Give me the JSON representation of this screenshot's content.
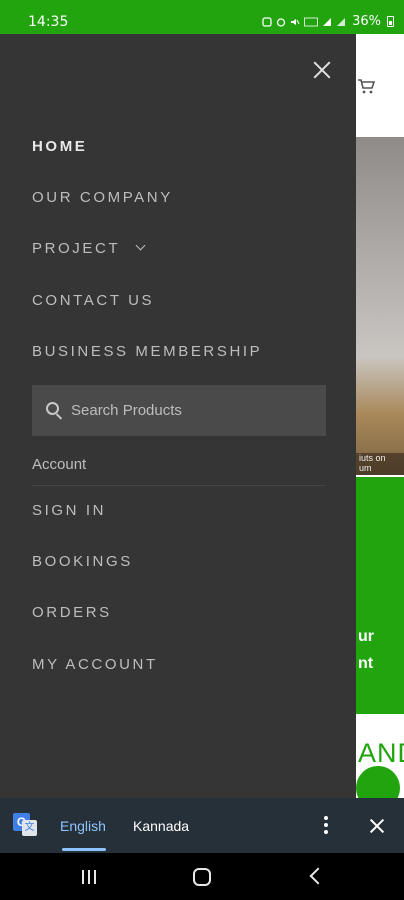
{
  "status_bar": {
    "time": "14:35",
    "battery": "36%",
    "icons": [
      "nfc-icon",
      "alarm-icon",
      "mute-icon",
      "volte-icon",
      "signal-icon",
      "signal-icon",
      "battery-icon"
    ]
  },
  "drawer": {
    "menu": [
      {
        "label": "HOME",
        "active": true
      },
      {
        "label": "OUR COMPANY"
      },
      {
        "label": "PROJECT",
        "has_dropdown": true
      },
      {
        "label": "CONTACT US"
      },
      {
        "label": "BUSINESS MEMBERSHIP"
      }
    ],
    "search": {
      "placeholder": "Search Products",
      "value": ""
    },
    "account": {
      "heading": "Account",
      "items": [
        {
          "label": "SIGN IN"
        },
        {
          "label": "BOOKINGS"
        },
        {
          "label": "ORDERS"
        },
        {
          "label": "MY ACCOUNT"
        }
      ]
    }
  },
  "background_page": {
    "caption": "iuts on\num",
    "banner_text": "ur\nnt",
    "heading_fragment": "AND"
  },
  "translate_bar": {
    "languages": [
      "English",
      "Kannada"
    ],
    "selected": "English"
  },
  "colors": {
    "brand_green": "#22a40f",
    "drawer_bg": "#353535",
    "translate_bar_bg": "#263038",
    "translate_accent": "#8fc3ff"
  }
}
